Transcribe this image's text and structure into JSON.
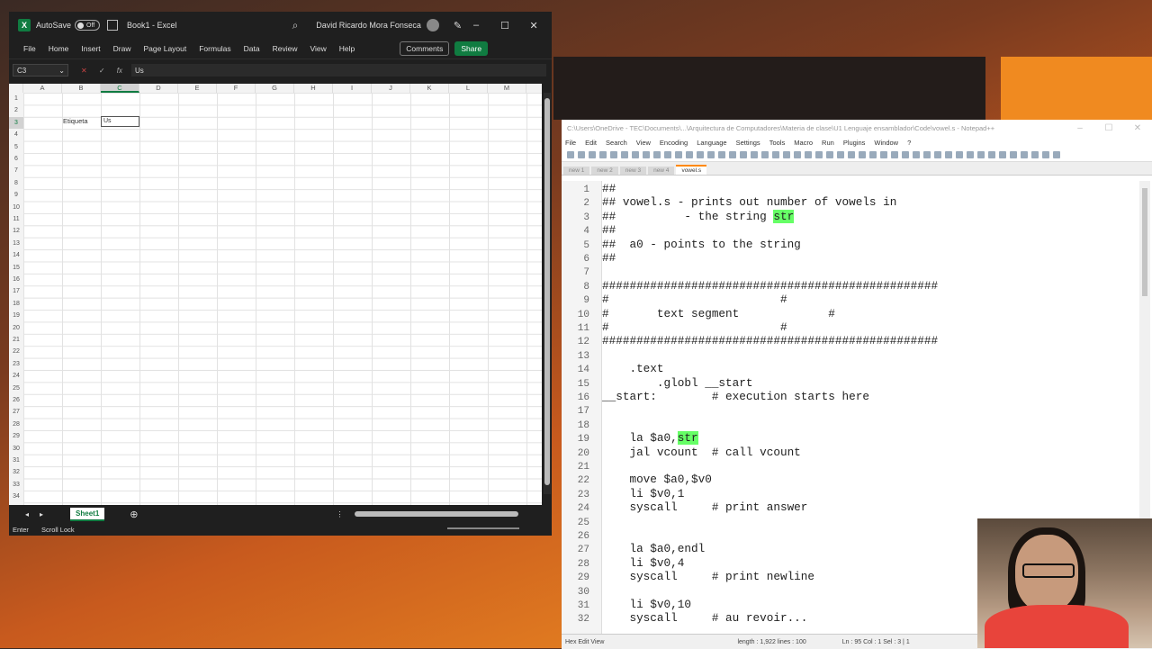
{
  "excel": {
    "autosave_label": "AutoSave",
    "autosave_state": "Off",
    "book_title": "Book1 - Excel",
    "user_name": "David Ricardo Mora Fonseca",
    "ribbon_tabs": [
      "File",
      "Home",
      "Insert",
      "Draw",
      "Page Layout",
      "Formulas",
      "Data",
      "Review",
      "View",
      "Help"
    ],
    "comments_label": "Comments",
    "share_label": "Share",
    "name_box": "C3",
    "formula_value": "Us",
    "columns": [
      "A",
      "B",
      "C",
      "D",
      "E",
      "F",
      "G",
      "H",
      "I",
      "J",
      "K",
      "L",
      "M"
    ],
    "selected_column": "C",
    "rows": [
      "1",
      "2",
      "3",
      "4",
      "5",
      "6",
      "7",
      "8",
      "9",
      "10",
      "11",
      "12",
      "13",
      "14",
      "15",
      "16",
      "17",
      "18",
      "19",
      "20",
      "21",
      "22",
      "23",
      "24",
      "25",
      "26",
      "27",
      "28",
      "29",
      "30",
      "31",
      "32",
      "33",
      "34"
    ],
    "selected_row": "3",
    "cell_b3": "Etiqueta",
    "cell_c3": "Us",
    "sheet_tab": "Sheet1",
    "status_mode": "Enter",
    "status_scroll": "Scroll Lock"
  },
  "npp": {
    "title": "C:\\Users\\OneDrive - TEC\\Documents\\...\\Arquitectura de Computadores\\Materia de clase\\U1 Lenguaje ensamblador\\Code\\vowel.s - Notepad++",
    "menu": [
      "File",
      "Edit",
      "Search",
      "View",
      "Encoding",
      "Language",
      "Settings",
      "Tools",
      "Macro",
      "Run",
      "Plugins",
      "Window",
      "?"
    ],
    "tabs": [
      "new 1",
      "new 2",
      "new 3",
      "new 4",
      "vowel.s"
    ],
    "active_tab": "vowel.s",
    "lines": [
      {
        "n": "1",
        "t": "##"
      },
      {
        "n": "2",
        "t": "## vowel.s - prints out number of vowels in"
      },
      {
        "n": "3",
        "t": "##          - the string ",
        "h": "str"
      },
      {
        "n": "4",
        "t": "##"
      },
      {
        "n": "5",
        "t": "##  a0 - points to the string"
      },
      {
        "n": "6",
        "t": "##"
      },
      {
        "n": "7",
        "t": ""
      },
      {
        "n": "8",
        "t": "#################################################"
      },
      {
        "n": "9",
        "t": "#                         #"
      },
      {
        "n": "10",
        "t": "#       text segment             #"
      },
      {
        "n": "11",
        "t": "#                         #"
      },
      {
        "n": "12",
        "t": "#################################################"
      },
      {
        "n": "13",
        "t": ""
      },
      {
        "n": "14",
        "t": "    .text"
      },
      {
        "n": "15",
        "t": "        .globl __start"
      },
      {
        "n": "16",
        "t": "__start:        # execution starts here"
      },
      {
        "n": "17",
        "t": ""
      },
      {
        "n": "18",
        "t": ""
      },
      {
        "n": "19",
        "t": "    la $a0,",
        "h": "str"
      },
      {
        "n": "20",
        "t": "    jal vcount  # call vcount"
      },
      {
        "n": "21",
        "t": ""
      },
      {
        "n": "22",
        "t": "    move $a0,$v0"
      },
      {
        "n": "23",
        "t": "    li $v0,1"
      },
      {
        "n": "24",
        "t": "    syscall     # print answer"
      },
      {
        "n": "25",
        "t": ""
      },
      {
        "n": "26",
        "t": ""
      },
      {
        "n": "27",
        "t": "    la $a0,endl"
      },
      {
        "n": "28",
        "t": "    li $v0,4"
      },
      {
        "n": "29",
        "t": "    syscall     # print newline"
      },
      {
        "n": "30",
        "t": ""
      },
      {
        "n": "31",
        "t": "    li $v0,10"
      },
      {
        "n": "32",
        "t": "    syscall     # au revoir..."
      }
    ],
    "status_left": "Hex Edit View",
    "status_length": "length : 1,922    lines : 100",
    "status_pos": "Ln : 95    Col : 1    Sel : 3 | 1"
  },
  "colors": {
    "excel_green": "#107c41",
    "highlight": "#66ff66"
  }
}
